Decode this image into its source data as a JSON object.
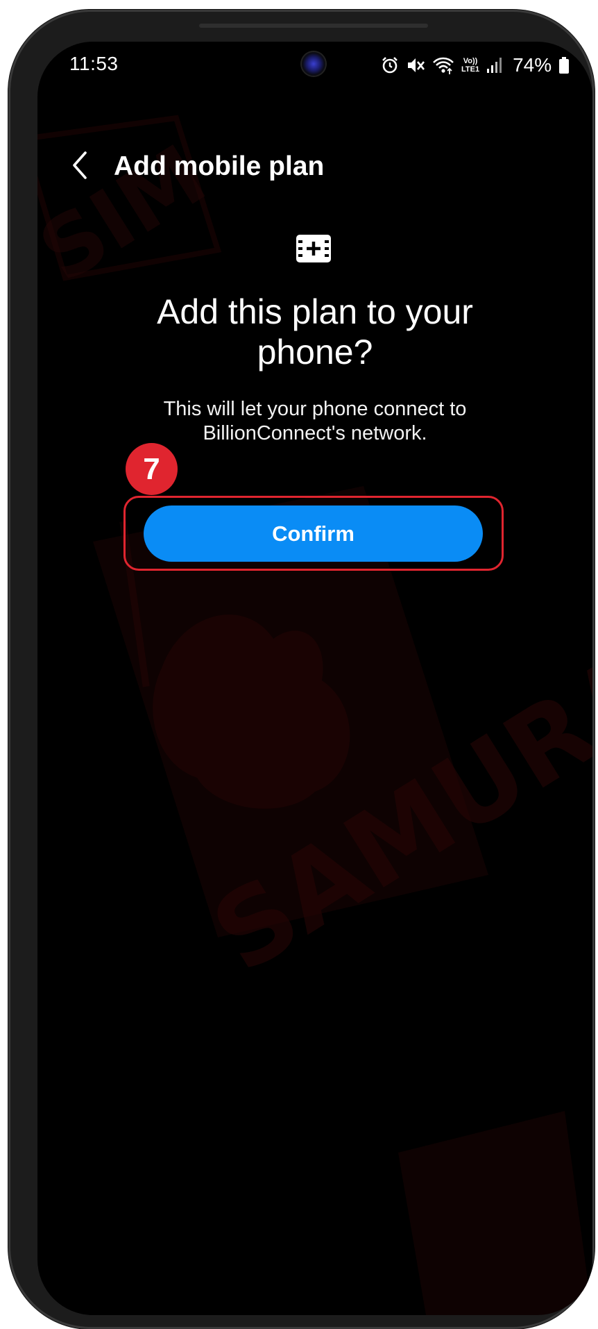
{
  "status_bar": {
    "time": "11:53",
    "network_label_top": "Vo))",
    "network_label_bottom": "LTE1",
    "battery_percent": "74%",
    "icons": [
      "alarm-icon",
      "mute-icon",
      "wifi-icon",
      "volte-icon",
      "signal-icon",
      "battery-icon"
    ]
  },
  "header": {
    "back_icon": "chevron-left-icon",
    "title": "Add mobile plan"
  },
  "content": {
    "icon": "sim-add-icon",
    "title_line1": "Add this plan to your",
    "title_line2": "phone?",
    "description_line1": "This will let your phone connect to",
    "description_line2": "BillionConnect's network."
  },
  "annotation": {
    "step_number": "7",
    "color": "#e0252f"
  },
  "confirm_button": {
    "label": "Confirm",
    "color": "#0a8cf5"
  },
  "watermark": {
    "text": "SAMURAI SIM"
  }
}
